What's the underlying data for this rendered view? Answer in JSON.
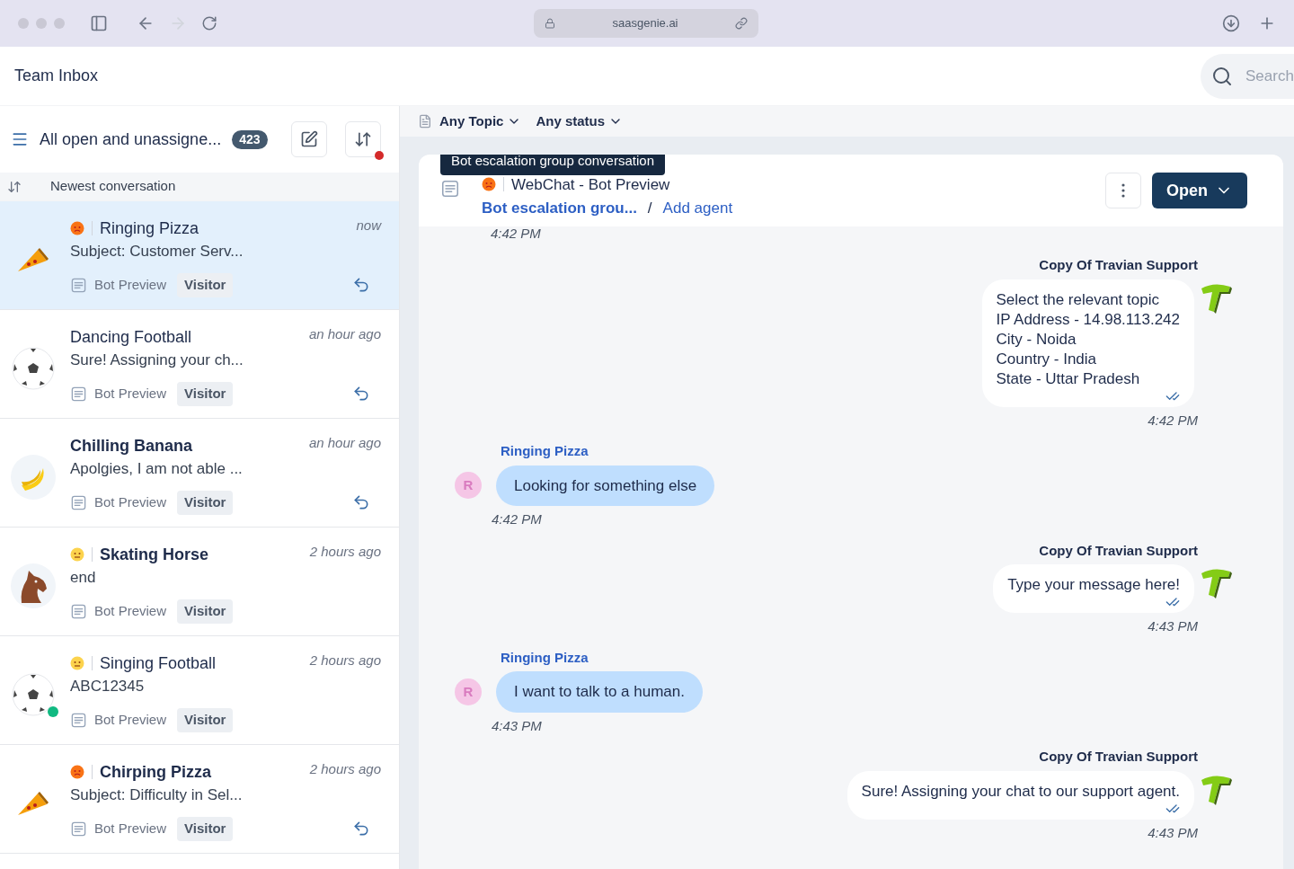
{
  "browser": {
    "url": "saasgenie.ai"
  },
  "header": {
    "title": "Team Inbox",
    "search": {
      "placeholder": "Search"
    }
  },
  "inbox": {
    "filter": "All open and unassigne...",
    "count": "423",
    "sort": "Newest conversation",
    "sort_dot": true,
    "conversations": [
      {
        "avatar": {
          "kind": "pizza"
        },
        "mood": {
          "kind": "angry"
        },
        "name": "Ringing Pizza",
        "unread": false,
        "preview": "Subject: Customer Serv...",
        "time": "now",
        "channel": "Bot Preview",
        "tag": "Visitor",
        "replied": true,
        "online": false,
        "selected": true
      },
      {
        "avatar": {
          "kind": "football"
        },
        "name": "Dancing Football",
        "unread": false,
        "preview": "Sure! Assigning your ch...",
        "time": "an hour ago",
        "channel": "Bot Preview",
        "tag": "Visitor",
        "replied": true,
        "online": false,
        "selected": false
      },
      {
        "avatar": {
          "kind": "banana"
        },
        "name": "Chilling Banana",
        "unread": true,
        "preview": "Apolgies, I am not able ...",
        "time": "an hour ago",
        "channel": "Bot Preview",
        "tag": "Visitor",
        "replied": true,
        "online": false,
        "selected": false
      },
      {
        "avatar": {
          "kind": "horse"
        },
        "mood": {
          "kind": "neutral"
        },
        "name": "Skating Horse",
        "unread": true,
        "preview": "end",
        "time": "2 hours ago",
        "channel": "Bot Preview",
        "tag": "Visitor",
        "replied": false,
        "online": false,
        "selected": false
      },
      {
        "avatar": {
          "kind": "football"
        },
        "mood": {
          "kind": "neutral"
        },
        "name": "Singing Football",
        "unread": false,
        "preview": "ABC12345",
        "time": "2 hours ago",
        "channel": "Bot Preview",
        "tag": "Visitor",
        "replied": false,
        "online": true,
        "selected": false
      },
      {
        "avatar": {
          "kind": "pizza"
        },
        "mood": {
          "kind": "angry"
        },
        "name": "Chirping Pizza",
        "unread": true,
        "preview": "Subject: Difficulty in Sel...",
        "time": "2 hours ago",
        "channel": "Bot Preview",
        "tag": "Visitor",
        "replied": true,
        "online": false,
        "selected": false
      }
    ]
  },
  "filters": [
    {
      "label": "Any Topic"
    },
    {
      "label": "Any status"
    }
  ],
  "chat": {
    "tooltip": "Bot escalation group conversation",
    "mood": {
      "kind": "angry"
    },
    "title": "WebChat - Bot Preview",
    "group": "Bot escalation grou...",
    "separator": "/",
    "add_agent": "Add agent",
    "status": "Open",
    "messages": [
      {
        "kind": "time",
        "time": "4:42 PM"
      },
      {
        "kind": "bot",
        "sender": "Copy Of Travian Support",
        "lines": [
          "Select the relevant topic",
          "IP Address - 14.98.113.242",
          "City - Noida",
          "Country - India",
          "State - Uttar Pradesh"
        ],
        "time": "4:42 PM"
      },
      {
        "kind": "visitor",
        "sender": "Ringing Pizza",
        "initial": "R",
        "lines": [
          "Looking for something else"
        ],
        "time": "4:42 PM"
      },
      {
        "kind": "bot",
        "sender": "Copy Of Travian Support",
        "lines": [
          "Type your message here!"
        ],
        "time": "4:43 PM"
      },
      {
        "kind": "visitor",
        "sender": "Ringing Pizza",
        "initial": "R",
        "lines": [
          "I want to talk to a human."
        ],
        "time": "4:43 PM"
      },
      {
        "kind": "bot",
        "sender": "Copy Of Travian Support",
        "lines": [
          "Sure! Assigning your chat to our support agent."
        ],
        "time": "4:43 PM"
      }
    ]
  }
}
